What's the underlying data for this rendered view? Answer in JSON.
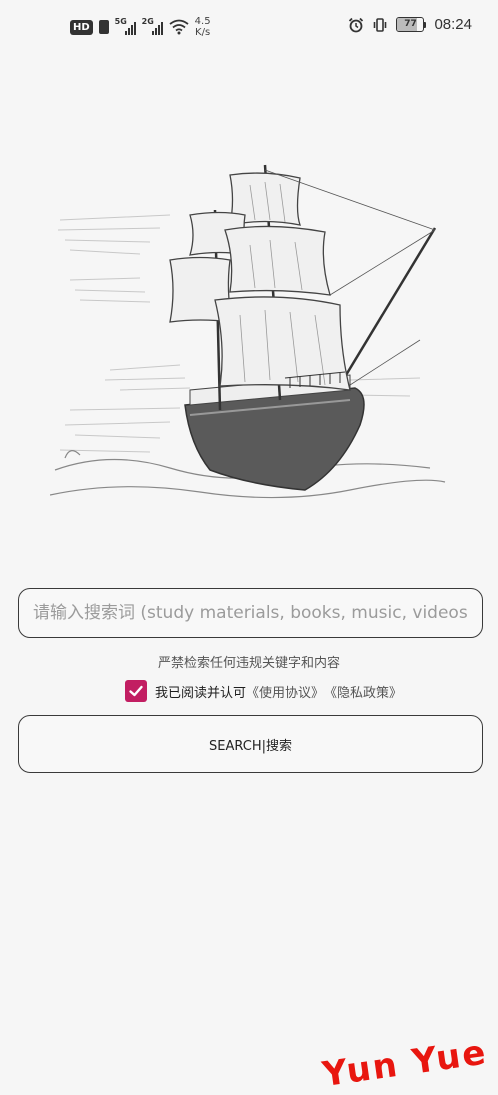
{
  "status_bar": {
    "hd_label": "HD",
    "net_1": "5G",
    "net_2": "2G",
    "speed_value": "4.5",
    "speed_unit": "K/s",
    "battery": "77",
    "battery_level": 0.77,
    "time": "08:24",
    "icons": [
      "hd-icon",
      "sim-icon",
      "signal-icon",
      "signal-icon",
      "wifi-icon",
      "alarm-icon",
      "vibrate-icon",
      "battery-icon"
    ]
  },
  "search": {
    "placeholder": "请输入搜索词 (study materials, books, music, videos,",
    "value": ""
  },
  "warning": "严禁检索任何违规关键字和内容",
  "agreement": {
    "checked": true,
    "text": "我已阅读并认可",
    "terms_link": "《使用协议》",
    "privacy_link": "《隐私政策》"
  },
  "search_button": "SEARCH|搜索",
  "watermark": "Yun Yue",
  "colors": {
    "background": "#f6f6f6",
    "checkbox": "#c21e62",
    "watermark": "#e8160f",
    "border": "#3a3a3a"
  }
}
